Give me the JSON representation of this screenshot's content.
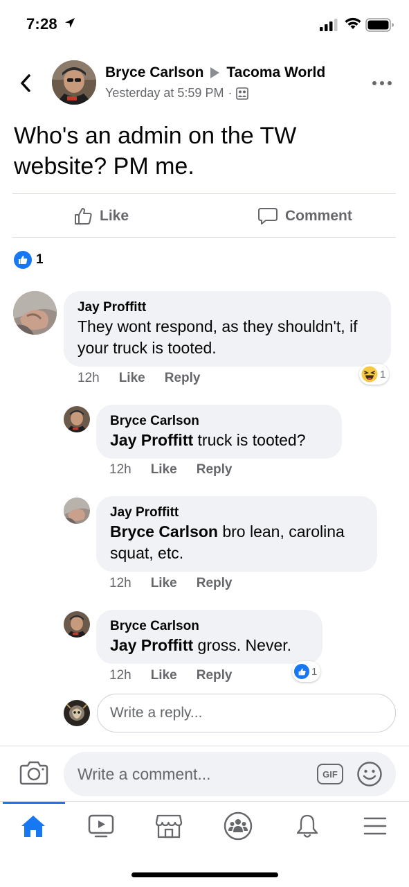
{
  "status_bar": {
    "time": "7:28"
  },
  "post": {
    "author": "Bryce Carlson",
    "group": "Tacoma World",
    "timestamp": "Yesterday at 5:59 PM",
    "separator": "·",
    "body": "Who's an admin on the TW website? PM me.",
    "reaction_count": "1"
  },
  "actions": {
    "like_label": "Like",
    "comment_label": "Comment"
  },
  "comments": [
    {
      "author": "Jay Proffitt",
      "tag": "",
      "text": "They wont respond, as they shouldn't, if your truck is tooted.",
      "time": "12h",
      "like_label": "Like",
      "reply_label": "Reply",
      "reaction": "haha",
      "reaction_count": "1"
    },
    {
      "author": "Bryce Carlson",
      "tag": "Jay Proffitt",
      "text": " truck is tooted?",
      "time": "12h",
      "like_label": "Like",
      "reply_label": "Reply"
    },
    {
      "author": "Jay Proffitt",
      "tag": "Bryce Carlson",
      "text": " bro lean, carolina squat, etc.",
      "time": "12h",
      "like_label": "Like",
      "reply_label": "Reply"
    },
    {
      "author": "Bryce Carlson",
      "tag": "Jay Proffitt",
      "text": " gross. Never.",
      "time": "12h",
      "like_label": "Like",
      "reply_label": "Reply",
      "reaction": "like",
      "reaction_count": "1"
    }
  ],
  "reply_input": {
    "placeholder": "Write a reply..."
  },
  "composer": {
    "placeholder": "Write a comment...",
    "gif_label": "GIF"
  },
  "tabbar": {
    "items": [
      "home-icon",
      "watch-icon",
      "marketplace-icon",
      "groups-icon",
      "notifications-icon",
      "menu-icon"
    ],
    "active": "home-icon"
  },
  "colors": {
    "accent": "#1877f2",
    "secondary_text": "#65676b",
    "bubble_bg": "#f0f2f5"
  }
}
